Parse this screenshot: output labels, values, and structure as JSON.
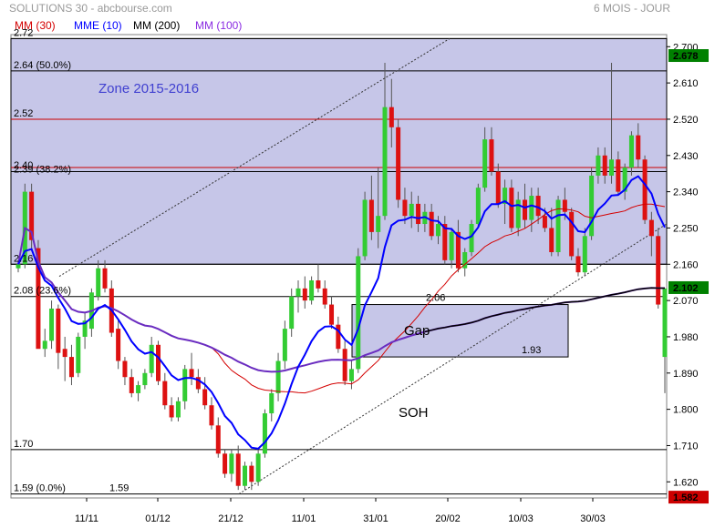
{
  "header": {
    "title": "SOLUTIONS 30 - abcbourse.com",
    "period": "6 MOIS - JOUR",
    "legend": [
      {
        "label": "MM (30)",
        "color": "#d40000"
      },
      {
        "label": "MME (10)",
        "color": "#0000ff"
      },
      {
        "label": "MM (200)",
        "color": "#000000"
      },
      {
        "label": "MM (100)",
        "color": "#8a2be2"
      }
    ]
  },
  "chart_data": {
    "type": "candlestick",
    "y_axis": {
      "ylim": [
        1.58,
        2.73
      ],
      "ticks": [
        "2.700",
        "2.610",
        "2.520",
        "2.430",
        "2.340",
        "2.250",
        "2.160",
        "2.070",
        "1.980",
        "1.890",
        "1.800",
        "1.710",
        "1.620"
      ]
    },
    "x_axis": {
      "labels": [
        "11/11",
        "01/12",
        "21/12",
        "11/01",
        "31/01",
        "20/02",
        "10/03",
        "30/03"
      ]
    },
    "price_badges": [
      {
        "value": "2.678",
        "color": "#008000"
      },
      {
        "value": "2.102",
        "color": "#008000"
      },
      {
        "value": "1.582",
        "color": "#cc0000"
      }
    ],
    "zone": {
      "label": "Zone 2015-2016",
      "top": 2.72,
      "bottom": 2.16
    },
    "gap": {
      "label": "Gap",
      "top_label": "2.06",
      "bottom_label": "1.93",
      "top": 2.06,
      "bottom": 1.93
    },
    "soh_label": "SOH",
    "levels": [
      {
        "value": 2.72,
        "label": "2.72",
        "color": "#000000"
      },
      {
        "value": 2.64,
        "label": "2.64",
        "fib": "(50.0%)",
        "color": "#000000"
      },
      {
        "value": 2.52,
        "label": "2.52",
        "color": "#cc0000"
      },
      {
        "value": 2.4,
        "label": "2.40",
        "color": "#cc0000"
      },
      {
        "value": 2.39,
        "label": "2.39",
        "fib": "(38.2%)",
        "color": "#000000"
      },
      {
        "value": 2.16,
        "label": "2.16",
        "color": "#000000"
      },
      {
        "value": 2.08,
        "label": "2.08",
        "fib": "(23.6%)",
        "color": "#000000"
      },
      {
        "value": 1.7,
        "label": "1.70",
        "color": "#000000"
      },
      {
        "value": 1.59,
        "label": "1.59",
        "fib": "(0.0%)",
        "color": "#000000"
      }
    ],
    "magenta_label": "1.59",
    "candles_ohlc": [
      [
        2.15,
        2.17,
        2.14,
        2.16
      ],
      [
        2.16,
        2.36,
        2.15,
        2.34
      ],
      [
        2.34,
        2.36,
        2.2,
        2.22
      ],
      [
        2.2,
        2.22,
        1.96,
        1.95
      ],
      [
        1.95,
        2.0,
        1.93,
        1.97
      ],
      [
        1.97,
        2.07,
        1.95,
        2.05
      ],
      [
        2.05,
        2.06,
        1.9,
        1.94
      ],
      [
        1.95,
        1.98,
        1.87,
        1.93
      ],
      [
        1.93,
        1.96,
        1.86,
        1.88
      ],
      [
        1.89,
        1.99,
        1.88,
        1.98
      ],
      [
        1.98,
        2.04,
        1.95,
        2.02
      ],
      [
        2.0,
        2.1,
        1.98,
        2.09
      ],
      [
        2.08,
        2.17,
        2.07,
        2.15
      ],
      [
        2.15,
        2.17,
        2.09,
        2.1
      ],
      [
        2.1,
        2.12,
        1.98,
        1.99
      ],
      [
        2.0,
        2.02,
        1.9,
        1.92
      ],
      [
        1.92,
        1.93,
        1.86,
        1.88
      ],
      [
        1.88,
        1.9,
        1.83,
        1.84
      ],
      [
        1.84,
        1.87,
        1.82,
        1.86
      ],
      [
        1.86,
        1.9,
        1.85,
        1.89
      ],
      [
        1.89,
        1.98,
        1.88,
        1.96
      ],
      [
        1.96,
        1.97,
        1.86,
        1.87
      ],
      [
        1.87,
        1.89,
        1.8,
        1.81
      ],
      [
        1.81,
        1.83,
        1.77,
        1.78
      ],
      [
        1.78,
        1.83,
        1.77,
        1.82
      ],
      [
        1.82,
        1.91,
        1.8,
        1.9
      ],
      [
        1.9,
        1.94,
        1.86,
        1.88
      ],
      [
        1.88,
        1.9,
        1.84,
        1.85
      ],
      [
        1.85,
        1.88,
        1.8,
        1.81
      ],
      [
        1.81,
        1.83,
        1.75,
        1.76
      ],
      [
        1.76,
        1.78,
        1.68,
        1.69
      ],
      [
        1.69,
        1.7,
        1.63,
        1.64
      ],
      [
        1.64,
        1.7,
        1.62,
        1.69
      ],
      [
        1.69,
        1.71,
        1.6,
        1.61
      ],
      [
        1.61,
        1.67,
        1.6,
        1.66
      ],
      [
        1.66,
        1.67,
        1.6,
        1.62
      ],
      [
        1.62,
        1.7,
        1.61,
        1.69
      ],
      [
        1.69,
        1.8,
        1.68,
        1.79
      ],
      [
        1.79,
        1.85,
        1.77,
        1.84
      ],
      [
        1.84,
        1.94,
        1.82,
        1.92
      ],
      [
        1.92,
        2.02,
        1.9,
        2.0
      ],
      [
        2.0,
        2.1,
        1.98,
        2.08
      ],
      [
        2.08,
        2.12,
        2.04,
        2.1
      ],
      [
        2.1,
        2.13,
        2.05,
        2.07
      ],
      [
        2.07,
        2.13,
        2.06,
        2.12
      ],
      [
        2.12,
        2.16,
        2.09,
        2.1
      ],
      [
        2.1,
        2.12,
        2.05,
        2.06
      ],
      [
        2.06,
        2.08,
        2.0,
        2.01
      ],
      [
        2.01,
        2.03,
        1.94,
        1.95
      ],
      [
        1.95,
        1.97,
        1.86,
        1.87
      ],
      [
        1.87,
        1.92,
        1.85,
        1.9
      ],
      [
        1.9,
        2.2,
        1.89,
        2.18
      ],
      [
        2.18,
        2.34,
        2.17,
        2.32
      ],
      [
        2.32,
        2.38,
        2.22,
        2.24
      ],
      [
        2.24,
        2.4,
        2.2,
        2.28
      ],
      [
        2.28,
        2.66,
        2.27,
        2.55
      ],
      [
        2.55,
        2.62,
        2.45,
        2.5
      ],
      [
        2.5,
        2.52,
        2.3,
        2.32
      ],
      [
        2.32,
        2.35,
        2.26,
        2.28
      ],
      [
        2.28,
        2.34,
        2.25,
        2.31
      ],
      [
        2.31,
        2.33,
        2.24,
        2.26
      ],
      [
        2.26,
        2.31,
        2.24,
        2.29
      ],
      [
        2.29,
        2.31,
        2.22,
        2.23
      ],
      [
        2.23,
        2.28,
        2.21,
        2.26
      ],
      [
        2.26,
        2.28,
        2.16,
        2.17
      ],
      [
        2.17,
        2.25,
        2.15,
        2.24
      ],
      [
        2.24,
        2.27,
        2.14,
        2.15
      ],
      [
        2.15,
        2.2,
        2.13,
        2.19
      ],
      [
        2.19,
        2.27,
        2.18,
        2.26
      ],
      [
        2.26,
        2.36,
        2.25,
        2.35
      ],
      [
        2.35,
        2.5,
        2.34,
        2.47
      ],
      [
        2.47,
        2.5,
        2.38,
        2.39
      ],
      [
        2.39,
        2.41,
        2.3,
        2.31
      ],
      [
        2.31,
        2.37,
        2.26,
        2.35
      ],
      [
        2.35,
        2.37,
        2.24,
        2.25
      ],
      [
        2.25,
        2.34,
        2.23,
        2.32
      ],
      [
        2.32,
        2.36,
        2.25,
        2.27
      ],
      [
        2.27,
        2.35,
        2.24,
        2.33
      ],
      [
        2.33,
        2.35,
        2.26,
        2.28
      ],
      [
        2.28,
        2.3,
        2.24,
        2.25
      ],
      [
        2.25,
        2.3,
        2.18,
        2.19
      ],
      [
        2.19,
        2.33,
        2.18,
        2.32
      ],
      [
        2.32,
        2.35,
        2.27,
        2.29
      ],
      [
        2.29,
        2.3,
        2.17,
        2.18
      ],
      [
        2.18,
        2.2,
        2.13,
        2.14
      ],
      [
        2.14,
        2.25,
        2.13,
        2.23
      ],
      [
        2.23,
        2.4,
        2.22,
        2.38
      ],
      [
        2.38,
        2.45,
        2.36,
        2.43
      ],
      [
        2.43,
        2.45,
        2.36,
        2.38
      ],
      [
        2.38,
        2.66,
        2.36,
        2.42
      ],
      [
        2.42,
        2.44,
        2.33,
        2.34
      ],
      [
        2.34,
        2.41,
        2.32,
        2.4
      ],
      [
        2.4,
        2.49,
        2.38,
        2.48
      ],
      [
        2.48,
        2.51,
        2.4,
        2.42
      ],
      [
        2.42,
        2.43,
        2.26,
        2.27
      ],
      [
        2.27,
        2.29,
        2.18,
        2.23
      ],
      [
        2.23,
        2.25,
        2.05,
        2.06
      ],
      [
        1.93,
        2.08,
        1.84,
        2.1
      ]
    ]
  }
}
